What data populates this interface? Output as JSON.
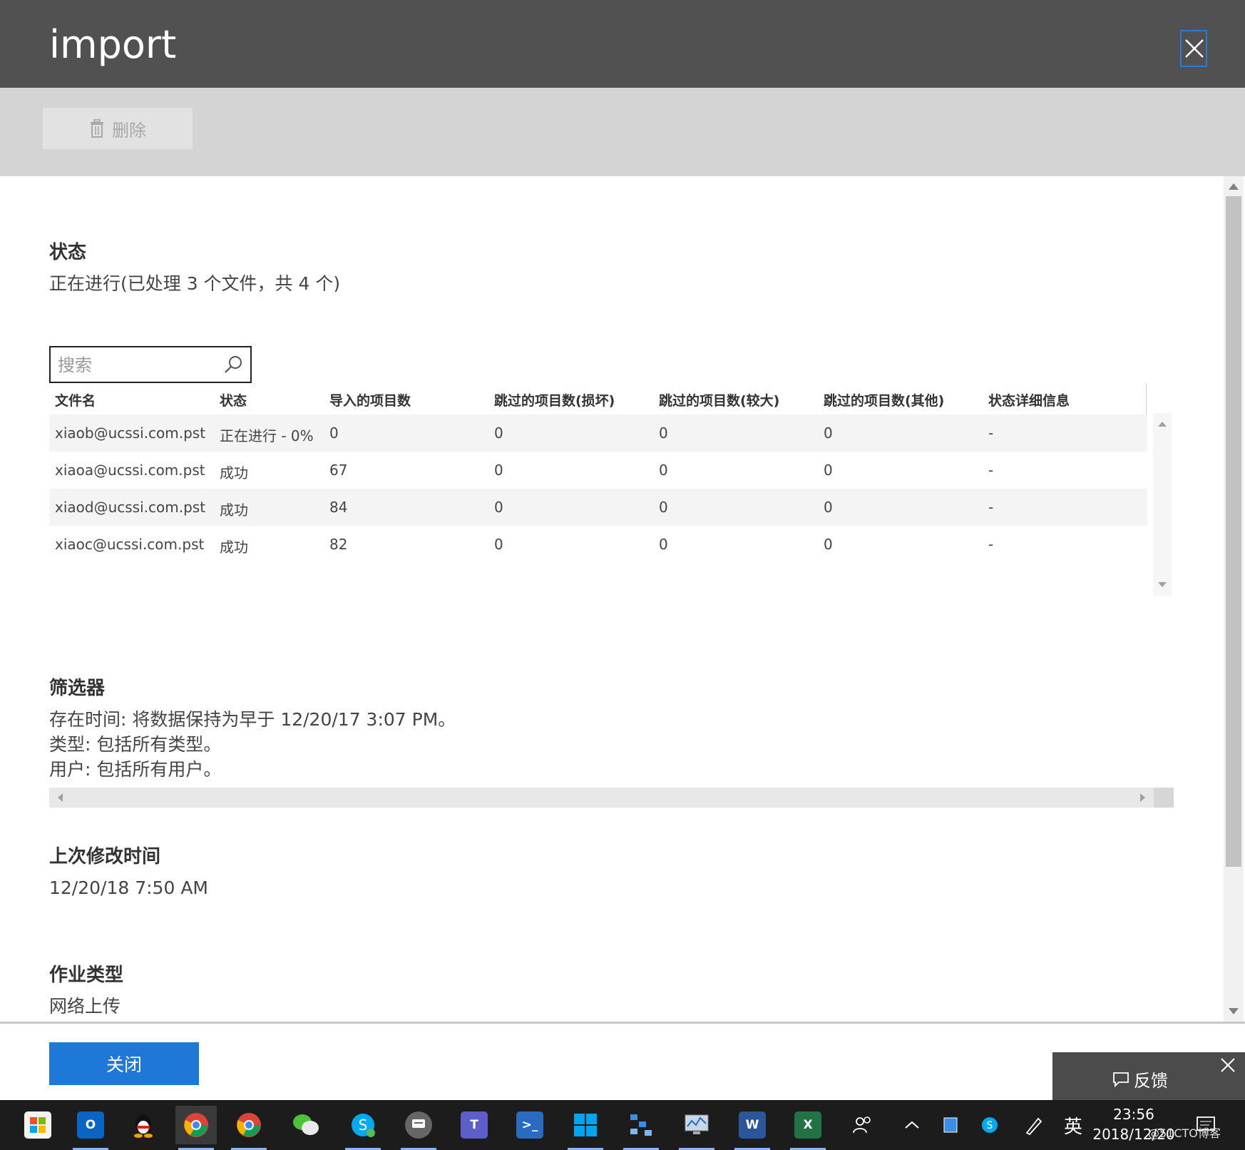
{
  "window": {
    "title": "import"
  },
  "toolbar": {
    "delete_label": "删除"
  },
  "status_section": {
    "heading": "状态",
    "text": "正在进行(已处理 3 个文件，共 4 个)"
  },
  "search": {
    "placeholder": "搜索"
  },
  "table": {
    "columns": [
      "文件名",
      "状态",
      "导入的项目数",
      "跳过的项目数(损坏)",
      "跳过的项目数(较大)",
      "跳过的项目数(其他)",
      "状态详细信息"
    ],
    "rows": [
      {
        "file": "xiaob@ucssi.com.pst",
        "status": "正在进行 - 0%",
        "imported": "0",
        "skipped_corrupt": "0",
        "skipped_large": "0",
        "skipped_other": "0",
        "detail": "-"
      },
      {
        "file": "xiaoa@ucssi.com.pst",
        "status": "成功",
        "imported": "67",
        "skipped_corrupt": "0",
        "skipped_large": "0",
        "skipped_other": "0",
        "detail": "-"
      },
      {
        "file": "xiaod@ucssi.com.pst",
        "status": "成功",
        "imported": "84",
        "skipped_corrupt": "0",
        "skipped_large": "0",
        "skipped_other": "0",
        "detail": "-"
      },
      {
        "file": "xiaoc@ucssi.com.pst",
        "status": "成功",
        "imported": "82",
        "skipped_corrupt": "0",
        "skipped_large": "0",
        "skipped_other": "0",
        "detail": "-"
      }
    ]
  },
  "filter_section": {
    "heading": "筛选器",
    "lines": [
      "存在时间: 将数据保持为早于 12/20/17 3:07 PM。",
      "类型: 包括所有类型。",
      "用户: 包括所有用户。"
    ]
  },
  "modified_section": {
    "heading": "上次修改时间",
    "text": "12/20/18 7:50 AM"
  },
  "jobtype_section": {
    "heading": "作业类型",
    "text": "网络上传"
  },
  "footer": {
    "close_label": "关闭"
  },
  "feedback": {
    "label": "反馈"
  },
  "taskbar": {
    "ime": "英",
    "time": "23:56",
    "date": "2018/12/20",
    "watermark": "@51CTO博客"
  },
  "colors": {
    "titlebar": "#515151",
    "toolbar": "#d4d4d4",
    "primary_button": "#1e78d7",
    "feedback_bg": "#4b4b4b",
    "taskbar": "#1c1c1c"
  }
}
